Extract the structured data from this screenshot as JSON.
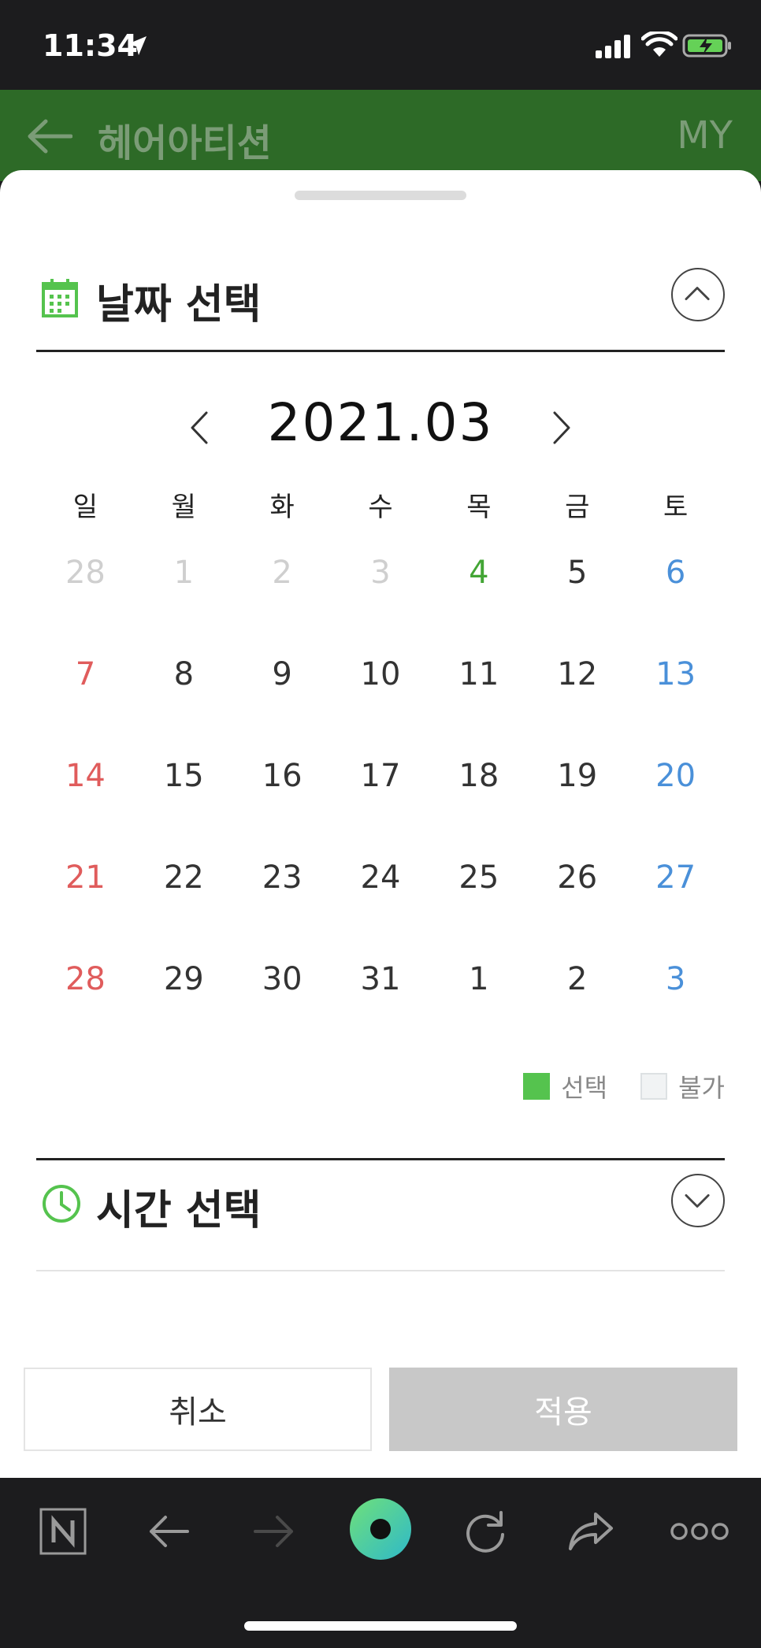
{
  "status_bar": {
    "time": "11:34"
  },
  "header": {
    "title": "헤어아티션",
    "my_label": "MY"
  },
  "date_section": {
    "title": "날짜 선택"
  },
  "calendar": {
    "month_label": "2021.03",
    "weekdays": [
      "일",
      "월",
      "화",
      "수",
      "목",
      "금",
      "토"
    ],
    "weeks": [
      [
        "28",
        "1",
        "2",
        "3",
        "4",
        "5",
        "6"
      ],
      [
        "7",
        "8",
        "9",
        "10",
        "11",
        "12",
        "13"
      ],
      [
        "14",
        "15",
        "16",
        "17",
        "18",
        "19",
        "20"
      ],
      [
        "21",
        "22",
        "23",
        "24",
        "25",
        "26",
        "27"
      ],
      [
        "28",
        "29",
        "30",
        "31",
        "1",
        "2",
        "3"
      ]
    ],
    "colors": {
      "sunday": "#e05c5c",
      "saturday": "#4a90d9",
      "today": "#43a535",
      "unavailable": "#cfcfcf"
    }
  },
  "legend": {
    "selected_label": "선택",
    "unavailable_label": "불가",
    "selected_color": "#55c34e"
  },
  "time_section": {
    "title": "시간 선택"
  },
  "buttons": {
    "cancel": "취소",
    "apply": "적용"
  },
  "toolbar": {
    "items": [
      "naver-home-icon",
      "back-arrow-icon",
      "forward-arrow-icon",
      "green-dot-icon",
      "reload-icon",
      "share-icon",
      "more-icon"
    ]
  }
}
